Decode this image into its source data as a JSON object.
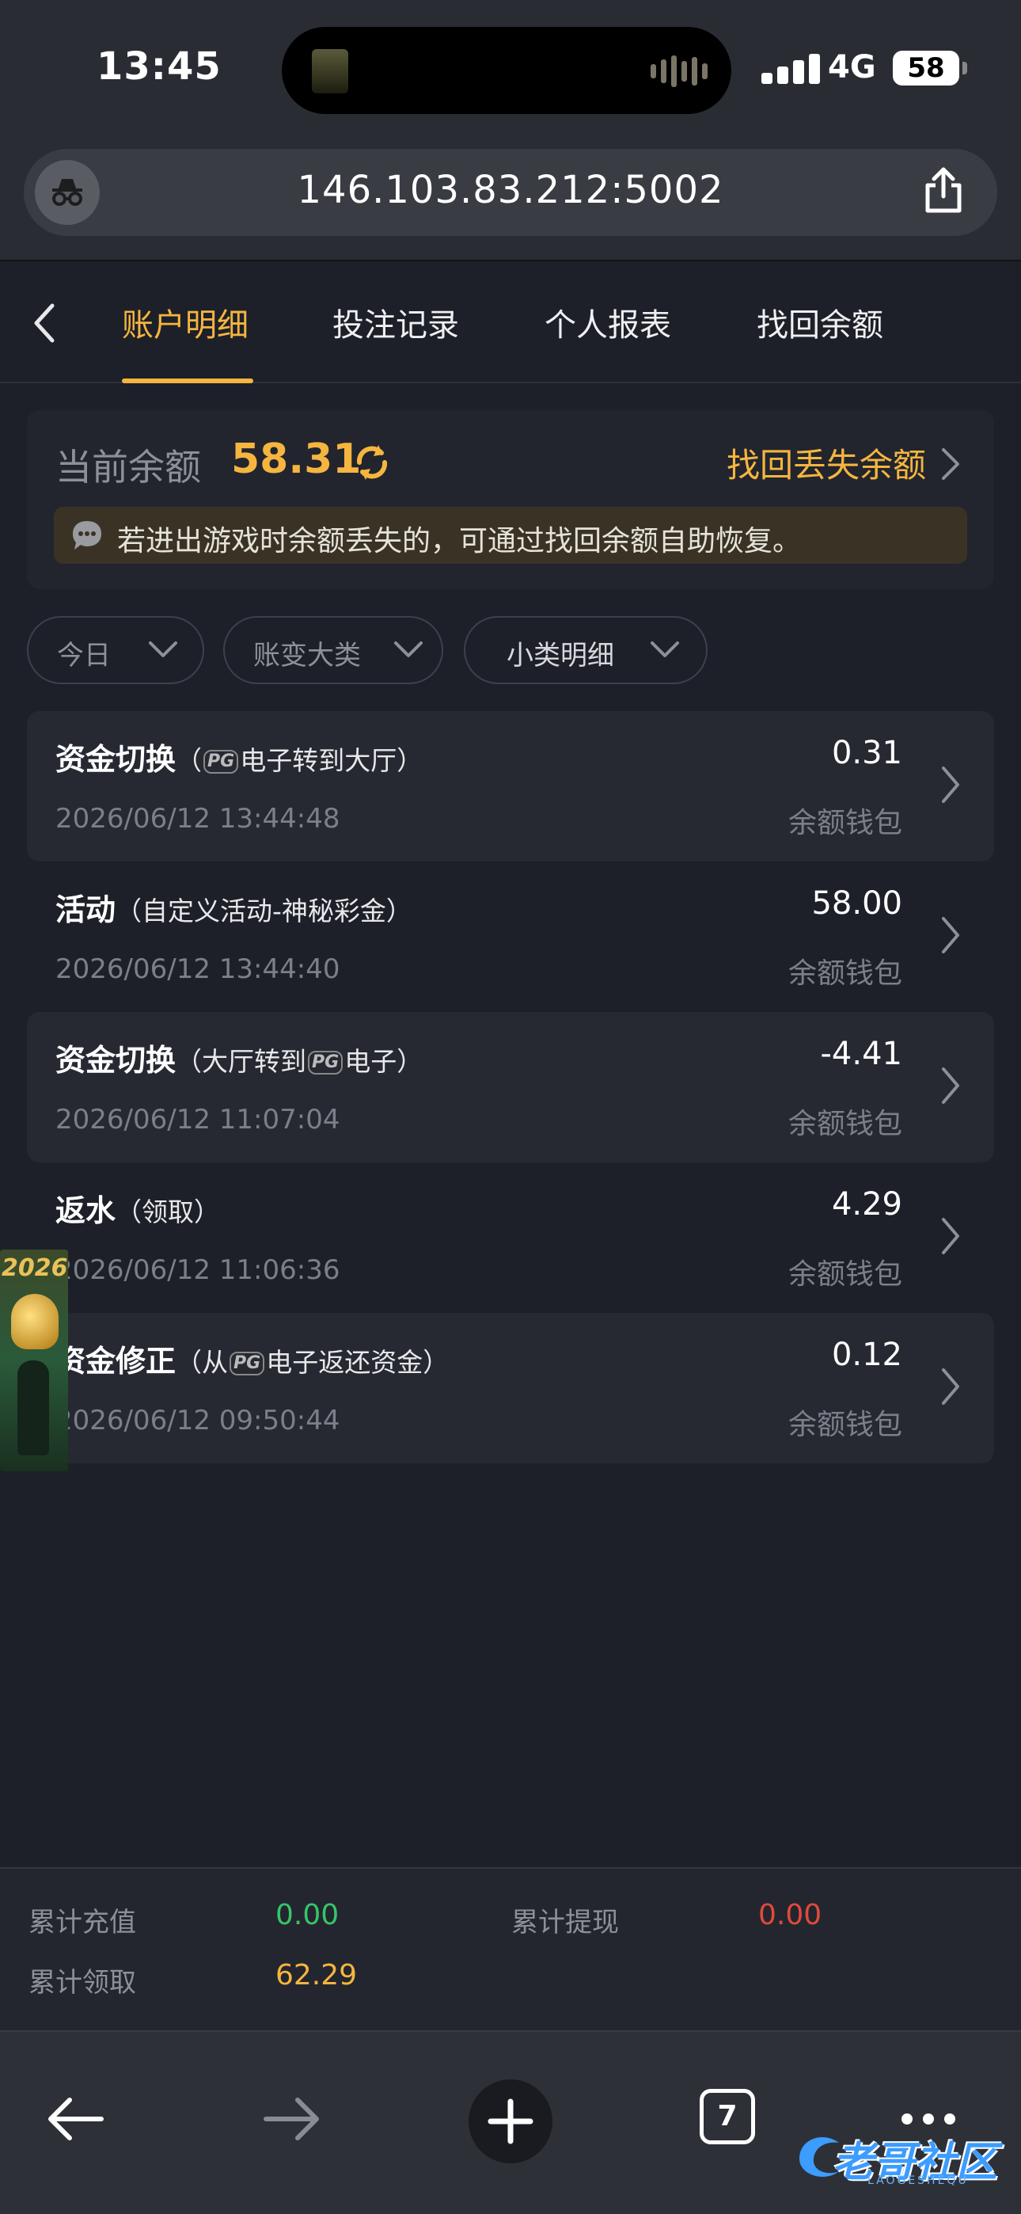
{
  "status_bar": {
    "time": "13:45",
    "network": "4G",
    "battery": "58"
  },
  "browser": {
    "url": "146.103.83.212:5002",
    "tab_count": "7"
  },
  "tabs": [
    {
      "label": "账户明细",
      "active": true
    },
    {
      "label": "投注记录",
      "active": false
    },
    {
      "label": "个人报表",
      "active": false
    },
    {
      "label": "找回余额",
      "active": false
    }
  ],
  "balance": {
    "label": "当前余额",
    "value": "58.31",
    "recover_link": "找回丢失余额",
    "notice": "若进出游戏时余额丢失的，可通过找回余额自助恢复。"
  },
  "filters": [
    {
      "label": "今日"
    },
    {
      "label": "账变大类"
    },
    {
      "label": "小类明细"
    }
  ],
  "records": [
    {
      "type": "资金切换",
      "detail_pre": "（",
      "detail_post": "电子转到大厅）",
      "has_pg": true,
      "date": "2026/06/12 13:44:48",
      "amount": "0.31",
      "wallet": "余额钱包"
    },
    {
      "type": "活动",
      "detail_pre": "（自定义活动-神秘彩金）",
      "detail_post": "",
      "has_pg": false,
      "date": "2026/06/12 13:44:40",
      "amount": "58.00",
      "wallet": "余额钱包"
    },
    {
      "type": "资金切换",
      "detail_pre": "（大厅转到",
      "detail_post": "电子）",
      "has_pg": true,
      "date": "2026/06/12 11:07:04",
      "amount": "-4.41",
      "wallet": "余额钱包"
    },
    {
      "type": "返水",
      "detail_pre": "（领取）",
      "detail_post": "",
      "has_pg": false,
      "date": "2026/06/12 11:06:36",
      "amount": "4.29",
      "wallet": "余额钱包"
    },
    {
      "type": "资金修正",
      "detail_pre": "（从",
      "detail_post": "电子返还资金）",
      "has_pg": true,
      "date": "2026/06/12 09:50:44",
      "amount": "0.12",
      "wallet": "余额钱包"
    }
  ],
  "pg_logo": "PG",
  "float_ad": {
    "year": "2026"
  },
  "summary": {
    "recharge_label": "累计充值",
    "recharge_value": "0.00",
    "withdraw_label": "累计提现",
    "withdraw_value": "0.00",
    "claim_label": "累计领取",
    "claim_value": "62.29"
  },
  "watermark": {
    "text": "老哥社区",
    "sub": "LAOGESHEQU"
  },
  "colors": {
    "accent": "#f5b53f",
    "green": "#36c46a",
    "red": "#e04a3a",
    "bg": "#1d2029"
  }
}
